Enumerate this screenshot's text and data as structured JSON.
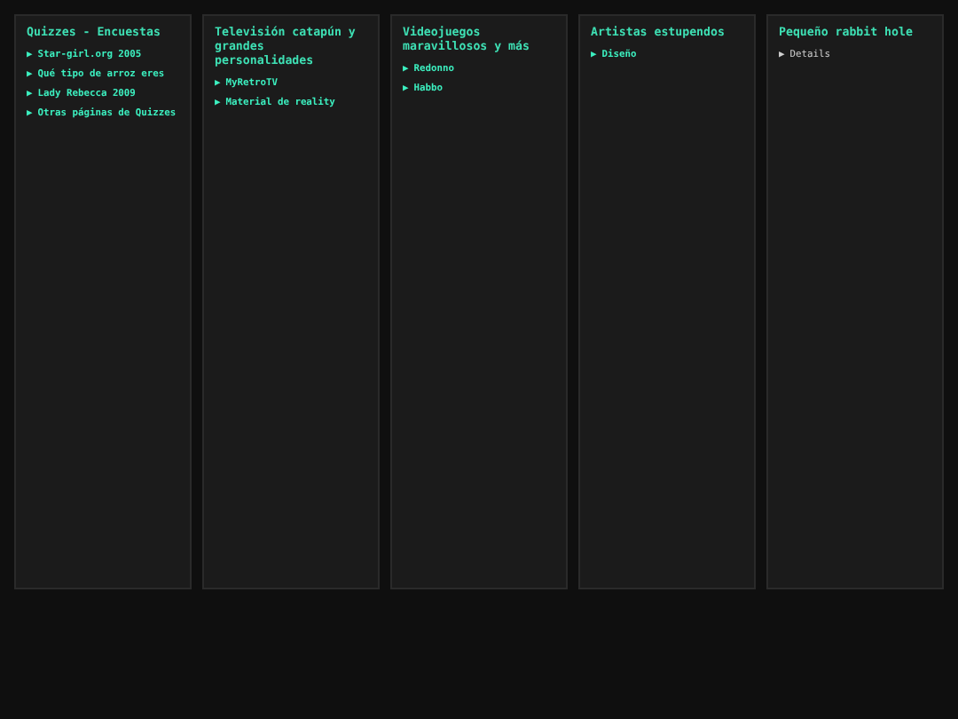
{
  "panels": [
    {
      "title": "Quizzes - Encuestas",
      "items": [
        {
          "kind": "link",
          "marker": "▶",
          "label": "Star-girl.org 2005"
        },
        {
          "kind": "link",
          "marker": "▶",
          "label": "Qué tipo de arroz eres"
        },
        {
          "kind": "link",
          "marker": "▶",
          "label": "Lady Rebecca 2009"
        },
        {
          "kind": "link",
          "marker": "▶",
          "label": "Otras páginas de Quizzes"
        }
      ]
    },
    {
      "title": "Televisión catapún y grandes personalidades",
      "items": [
        {
          "kind": "link",
          "marker": "▶",
          "label": "MyRetroTV"
        },
        {
          "kind": "link",
          "marker": "▶",
          "label": "Material de reality"
        }
      ]
    },
    {
      "title": "Videojuegos maravillosos y más",
      "items": [
        {
          "kind": "link",
          "marker": "▶",
          "label": "Redonno"
        },
        {
          "kind": "link",
          "marker": "▶",
          "label": "Habbo"
        }
      ]
    },
    {
      "title": "Artistas estupendos",
      "items": [
        {
          "kind": "link",
          "marker": "▶",
          "label": "Diseño"
        }
      ]
    },
    {
      "title": "Pequeño rabbit hole",
      "items": [
        {
          "kind": "details",
          "marker": "▶",
          "label": "Details"
        }
      ]
    }
  ]
}
